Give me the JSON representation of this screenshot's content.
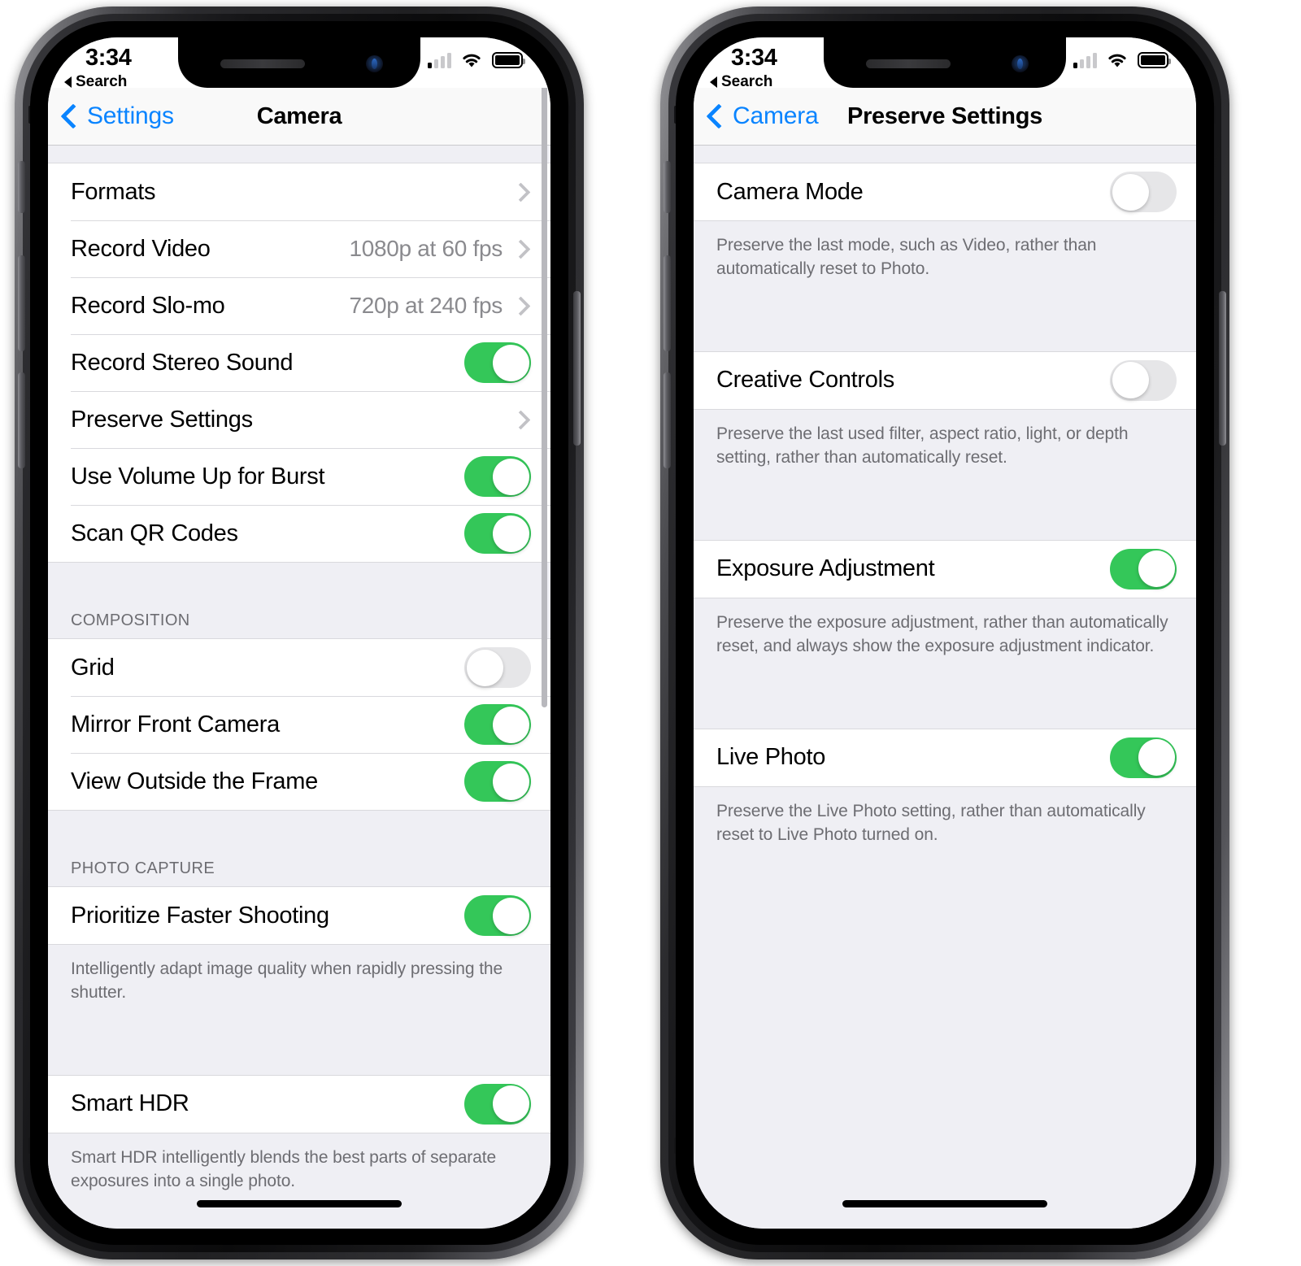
{
  "statusbar": {
    "time": "3:34",
    "back_app": "Search",
    "location_icon": "location-arrow-icon",
    "cellular_icon": "cellular-bars-icon",
    "wifi_icon": "wifi-icon",
    "battery_icon": "battery-full-icon"
  },
  "colors": {
    "toggle_on": "#34C759",
    "toggle_off": "#E6E6E8",
    "accent_blue": "#0A84FF",
    "table_background": "#EFEFF4",
    "cell_background": "#FFFFFF",
    "secondary_text": "#6D6D72"
  },
  "left_phone": {
    "nav": {
      "back_label": "Settings",
      "title": "Camera"
    },
    "sections": [
      {
        "header": "",
        "rows": [
          {
            "label": "Formats",
            "type": "disclosure",
            "value": ""
          },
          {
            "label": "Record Video",
            "type": "disclosure",
            "value": "1080p at 60 fps"
          },
          {
            "label": "Record Slo-mo",
            "type": "disclosure",
            "value": "720p at 240 fps"
          },
          {
            "label": "Record Stereo Sound",
            "type": "switch",
            "on": true
          },
          {
            "label": "Preserve Settings",
            "type": "disclosure",
            "value": ""
          },
          {
            "label": "Use Volume Up for Burst",
            "type": "switch",
            "on": true
          },
          {
            "label": "Scan QR Codes",
            "type": "switch",
            "on": true
          }
        ],
        "footer": ""
      },
      {
        "header": "COMPOSITION",
        "rows": [
          {
            "label": "Grid",
            "type": "switch",
            "on": false
          },
          {
            "label": "Mirror Front Camera",
            "type": "switch",
            "on": true
          },
          {
            "label": "View Outside the Frame",
            "type": "switch",
            "on": true
          }
        ],
        "footer": ""
      },
      {
        "header": "PHOTO CAPTURE",
        "rows": [
          {
            "label": "Prioritize Faster Shooting",
            "type": "switch",
            "on": true
          }
        ],
        "footer": "Intelligently adapt image quality when rapidly pressing the shutter."
      },
      {
        "header": "",
        "rows": [
          {
            "label": "Smart HDR",
            "type": "switch",
            "on": true
          }
        ],
        "footer": "Smart HDR intelligently blends the best parts of separate exposures into a single photo."
      }
    ]
  },
  "right_phone": {
    "nav": {
      "back_label": "Camera",
      "title": "Preserve Settings"
    },
    "sections": [
      {
        "header": "",
        "rows": [
          {
            "label": "Camera Mode",
            "type": "switch",
            "on": false
          }
        ],
        "footer": "Preserve the last mode, such as Video, rather than automatically reset to Photo."
      },
      {
        "header": "",
        "rows": [
          {
            "label": "Creative Controls",
            "type": "switch",
            "on": false
          }
        ],
        "footer": "Preserve the last used filter, aspect ratio, light, or depth setting, rather than automatically reset."
      },
      {
        "header": "",
        "rows": [
          {
            "label": "Exposure Adjustment",
            "type": "switch",
            "on": true
          }
        ],
        "footer": "Preserve the exposure adjustment, rather than automatically reset, and always show the exposure adjustment indicator."
      },
      {
        "header": "",
        "rows": [
          {
            "label": "Live Photo",
            "type": "switch",
            "on": true
          }
        ],
        "footer": "Preserve the Live Photo setting, rather than automatically reset to Live Photo turned on."
      }
    ]
  }
}
